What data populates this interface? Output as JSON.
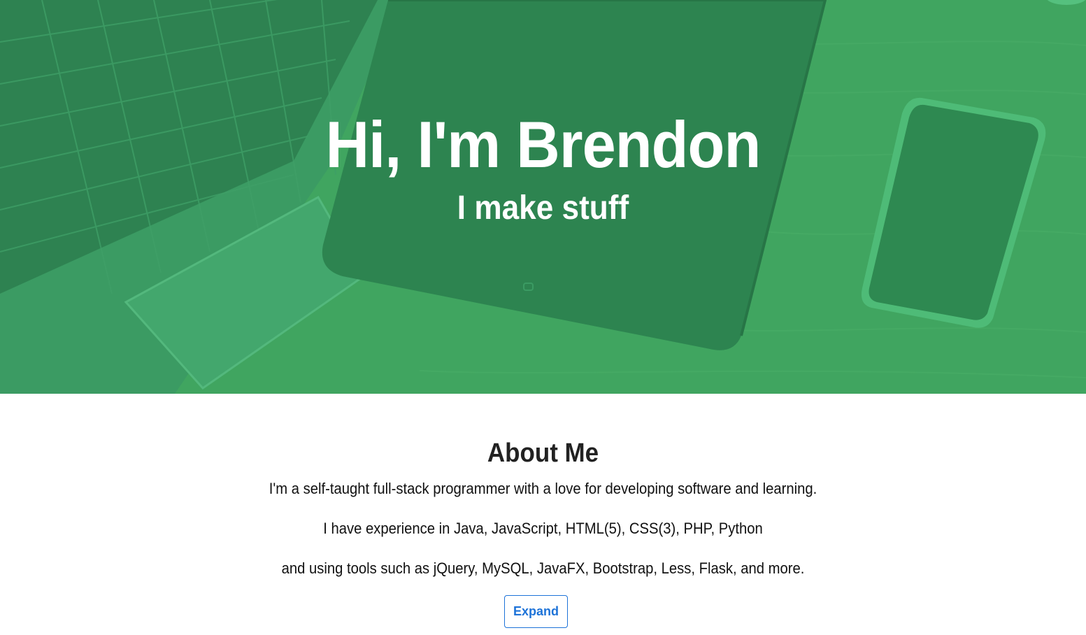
{
  "hero": {
    "title": "Hi, I'm Brendon",
    "subtitle": "I make stuff",
    "overlay_color": "#3f9b5c"
  },
  "about": {
    "heading": "About Me",
    "lines": [
      "I'm a self-taught full-stack programmer with a love for developing software and learning.",
      "I have experience in Java, JavaScript, HTML(5), CSS(3), PHP, Python",
      "and using tools such as jQuery, MySQL, JavaFX, Bootstrap, Less, Flask, and more."
    ],
    "expand_label": "Expand",
    "button_color": "#1e73d8"
  }
}
